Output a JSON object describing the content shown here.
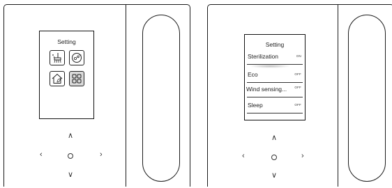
{
  "left_device": {
    "screen": {
      "title": "Setting",
      "tiles": [
        {
          "icon": "sweep-icon",
          "selected": false
        },
        {
          "icon": "ion-icon",
          "selected": false
        },
        {
          "icon": "home-leaf-icon",
          "selected": false
        },
        {
          "icon": "grid-icon",
          "selected": true
        }
      ]
    },
    "nav": {
      "up": "∧",
      "down": "∨",
      "left": "‹",
      "right": "›"
    }
  },
  "right_device": {
    "screen": {
      "title": "Setting",
      "rows": [
        {
          "label": "Sterilization",
          "state": "ON"
        },
        {
          "label": "Eco",
          "state": "OFF"
        },
        {
          "label": "Wind sensing...",
          "state": "OFF"
        },
        {
          "label": "Sleep",
          "state": "OFF"
        }
      ]
    },
    "nav": {
      "up": "∧",
      "down": "∨",
      "left": "‹",
      "right": "›"
    }
  }
}
